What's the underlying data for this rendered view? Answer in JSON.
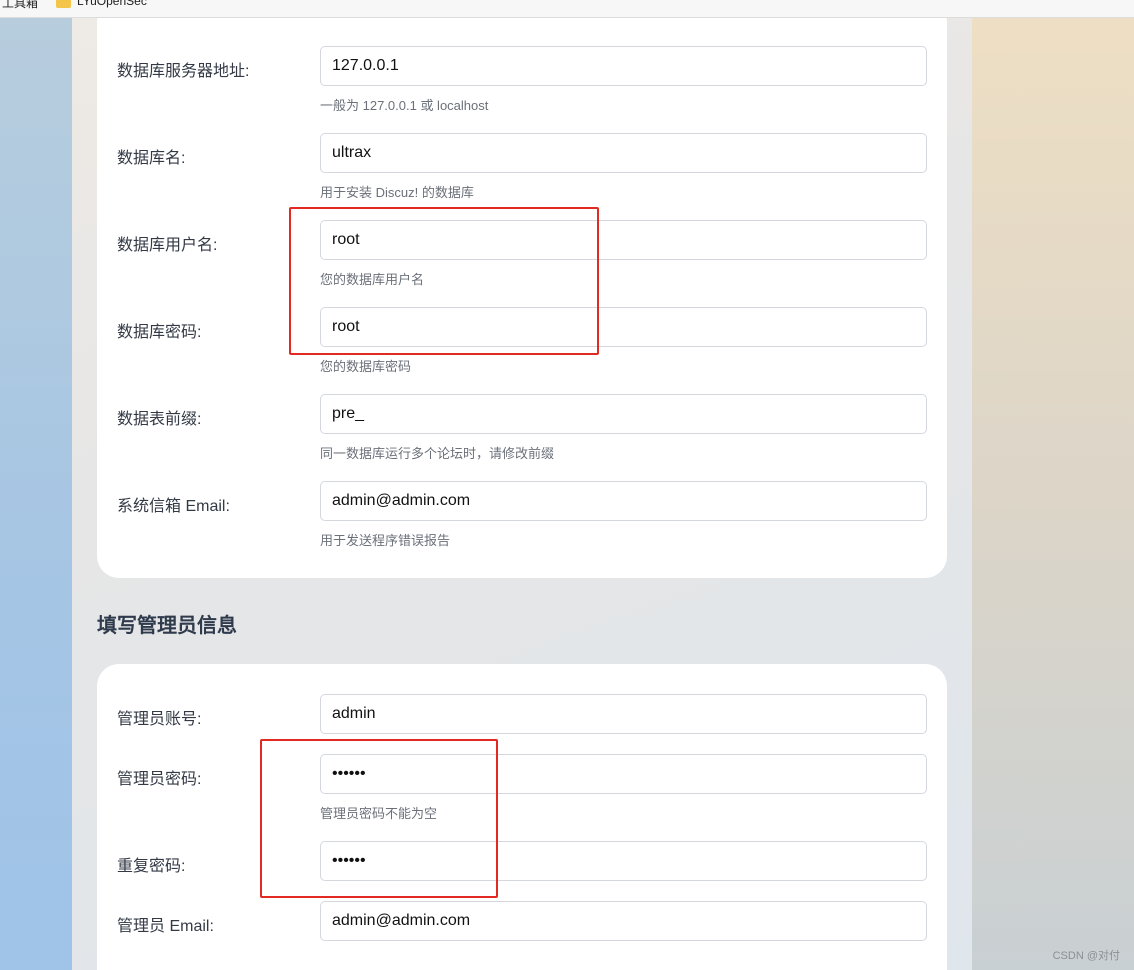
{
  "bookmarks_bar": {
    "apps_label": "工具箱",
    "folder_label": "LYuOpenSec"
  },
  "database_section": {
    "fields": [
      {
        "label": "数据库服务器地址:",
        "value": "127.0.0.1",
        "hint": "一般为 127.0.0.1 或 localhost"
      },
      {
        "label": "数据库名:",
        "value": "ultrax",
        "hint": "用于安装 Discuz! 的数据库"
      },
      {
        "label": "数据库用户名:",
        "value": "root",
        "hint": "您的数据库用户名"
      },
      {
        "label": "数据库密码:",
        "value": "root",
        "hint": "您的数据库密码"
      },
      {
        "label": "数据表前缀:",
        "value": "pre_",
        "hint": "同一数据库运行多个论坛时，请修改前缀"
      },
      {
        "label": "系统信箱 Email:",
        "value": "admin@admin.com",
        "hint": "用于发送程序错误报告"
      }
    ]
  },
  "admin_section": {
    "title": "填写管理员信息",
    "fields": [
      {
        "label": "管理员账号:",
        "value": "admin"
      },
      {
        "label": "管理员密码:",
        "value": "••••••",
        "hint": "管理员密码不能为空"
      },
      {
        "label": "重复密码:",
        "value": "••••••"
      },
      {
        "label": "管理员 Email:",
        "value": "admin@admin.com"
      }
    ]
  },
  "watermark": "CSDN @对付",
  "colors": {
    "annotation_red": "#e22a22",
    "section_title": "#2f3a4c"
  }
}
